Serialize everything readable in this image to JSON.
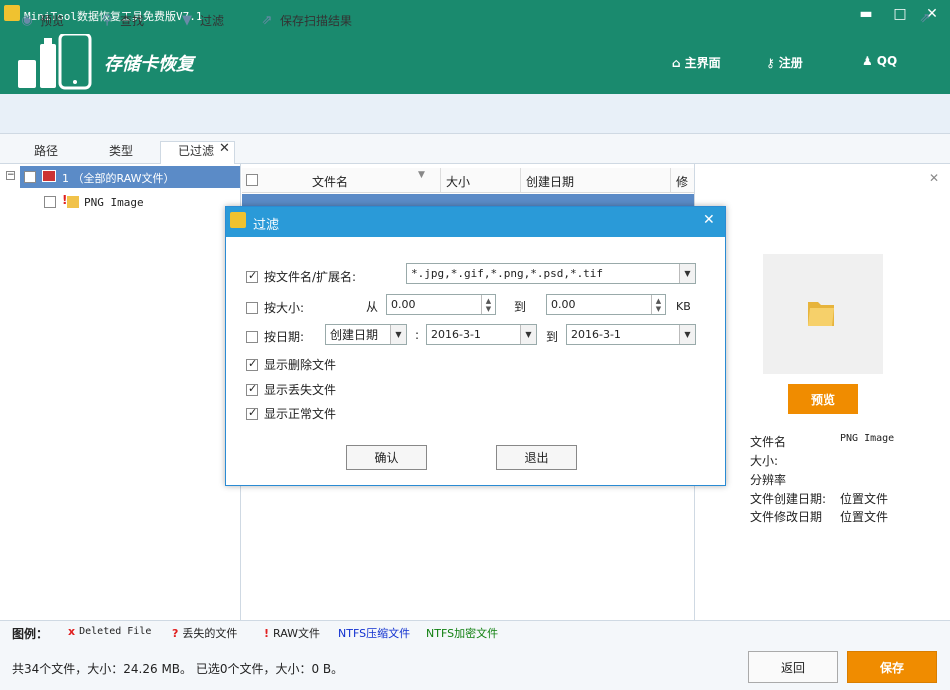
{
  "window": {
    "title": "MiniTool数据恢复工具免费版V7.1",
    "minimize": "▬",
    "maximize": "□",
    "close": "✕"
  },
  "header": {
    "product_title": "存储卡恢复",
    "nav": {
      "home": "主界面",
      "register": "注册",
      "qq": "QQ"
    }
  },
  "toolbar": {
    "preview": "预览",
    "find": "查找",
    "filter": "过滤",
    "save_scan": "保存扫描结果"
  },
  "tabs": {
    "path": "路径",
    "type": "类型",
    "filtered": "已过滤"
  },
  "tree": {
    "root_label": "1  （全部的RAW文件）",
    "child_label": "PNG Image"
  },
  "list": {
    "columns": [
      "文件名",
      "大小",
      "创建日期",
      "修"
    ]
  },
  "preview": {
    "button": "预览",
    "labels": {
      "name": "文件名",
      "size": "大小:",
      "resolution": "分辨率",
      "created": "文件创建日期:",
      "modified": "文件修改日期"
    },
    "values": {
      "name": "PNG Image",
      "created": "位置文件",
      "modified": "位置文件"
    }
  },
  "legend": {
    "title": "图例：",
    "deleted": "Deleted File",
    "lost": "丢失的文件",
    "raw": "RAW文件",
    "ntfs_comp": "NTFS压缩文件",
    "ntfs_enc": "NTFS加密文件",
    "colors": {
      "deleted": "#e02020",
      "ntfs_comp": "#1030d0",
      "ntfs_enc": "#108010"
    }
  },
  "status": {
    "summary": "共34个文件，大小：24.26 MB。 已选0个文件，大小：0 B。",
    "back": "返回",
    "save": "保存"
  },
  "dialog": {
    "title": "过滤",
    "by_name_label": "按文件名/扩展名:",
    "by_name_value": "*.jpg,*.gif,*.png,*.psd,*.tif",
    "by_size_label": "按大小:",
    "from": "从",
    "size_from": "0.00",
    "to": "到",
    "size_to": "0.00",
    "unit": "KB",
    "by_date_label": "按日期:",
    "date_type": "创建日期",
    "colon": ":",
    "date_from": "2016-3-1",
    "date_to": "2016-3-1",
    "show_deleted": "显示删除文件",
    "show_lost": "显示丢失文件",
    "show_normal": "显示正常文件",
    "ok": "确认",
    "exit": "退出"
  }
}
